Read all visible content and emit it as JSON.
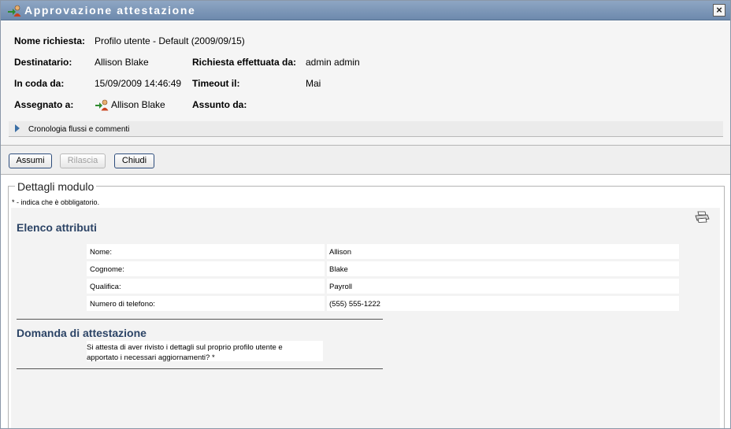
{
  "window": {
    "title": "Approvazione attestazione",
    "close_label": "×"
  },
  "info": {
    "request_name_label": "Nome richiesta:",
    "request_name_value": "Profilo utente - Default (2009/09/15)",
    "recipient_label": "Destinatario:",
    "recipient_value": "Allison Blake",
    "requested_by_label": "Richiesta effettuata da:",
    "requested_by_value": "admin admin",
    "queued_label": "In coda da:",
    "queued_value": "15/09/2009 14:46:49",
    "timeout_label": "Timeout il:",
    "timeout_value": "Mai",
    "assigned_label": "Assegnato a:",
    "assigned_value": "Allison Blake",
    "claimed_label": "Assunto da:"
  },
  "history": {
    "label": "Cronologia flussi e commenti"
  },
  "toolbar": {
    "claim_label": "Assumi",
    "release_label": "Rilascia",
    "close_label": "Chiudi"
  },
  "form": {
    "legend": "Dettagli modulo",
    "required_note": "* - indica che è obbligatorio.",
    "attributes_title": "Elenco attributi",
    "attributes": [
      {
        "label": "Nome:",
        "value": "Allison"
      },
      {
        "label": "Cognome:",
        "value": "Blake"
      },
      {
        "label": "Qualifica:",
        "value": "Payroll"
      },
      {
        "label": "Numero di telefono:",
        "value": "(555) 555-1222"
      }
    ],
    "question_title": "Domanda di attestazione",
    "question_line1": "Si attesta di aver rivisto i dettagli sul proprio profilo utente e",
    "question_line2": "apportato i necessari aggiornamenti? *"
  }
}
